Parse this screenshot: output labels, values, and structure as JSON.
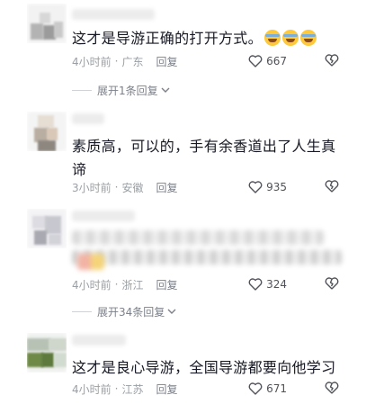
{
  "comments": [
    {
      "text": "这才是导游正确的打开方式。",
      "time": "4小时前",
      "location": "广东",
      "reply": "回复",
      "likes": "667",
      "expand": "展开1条回复"
    },
    {
      "text": "素质高，可以的，手有余香道出了人生真谛",
      "time": "3小时前",
      "location": "安徽",
      "reply": "回复",
      "likes": "935"
    },
    {
      "text": "",
      "time": "4小时前",
      "location": "浙江",
      "reply": "回复",
      "likes": "324",
      "expand": "展开34条回复"
    },
    {
      "text": "这才是良心导游，全国导游都要向他学习",
      "time": "4小时前",
      "location": "江苏",
      "reply": "回复",
      "likes": "671"
    }
  ],
  "icons": {
    "emoji": "laughing-tears-emoji",
    "like": "heart-outline-icon",
    "dislike": "broken-heart-icon",
    "expand": "chevron-down-icon"
  },
  "colors": {
    "text": "#161823",
    "meta": "#9aa0a6",
    "accent": "#7c8089"
  }
}
